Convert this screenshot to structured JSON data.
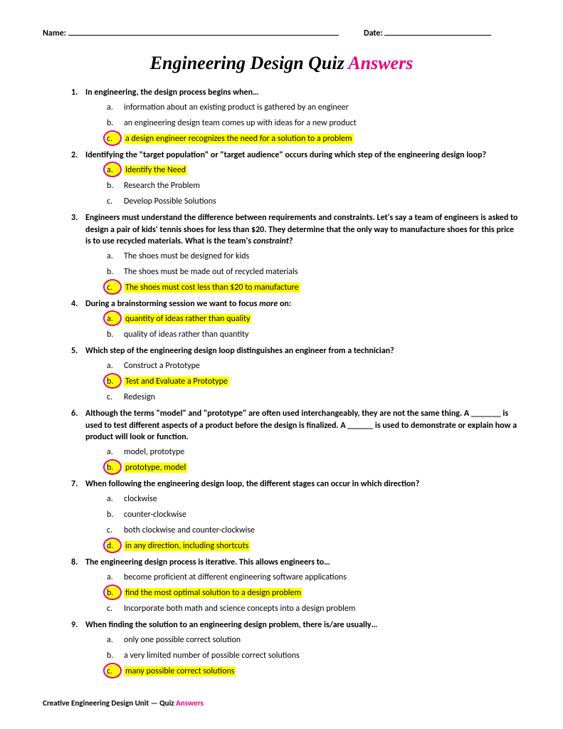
{
  "header": {
    "name_label": "Name:",
    "date_label": "Date:"
  },
  "title": {
    "main": "Engineering Design Quiz ",
    "answers": "Answers"
  },
  "questions": [
    {
      "text": "In engineering, the design process begins when…",
      "choices": [
        {
          "letter": "a.",
          "text": "information about an existing product is gathered by an engineer",
          "correct": false
        },
        {
          "letter": "b.",
          "text": "an engineering design team comes up with ideas for a new product",
          "correct": false
        },
        {
          "letter": "c.",
          "text": "a design engineer recognizes the need for a solution to a problem",
          "correct": true
        }
      ]
    },
    {
      "text": "Identifying the \"target population\" or \"target audience\" occurs during which step of the engineering design loop?",
      "choices": [
        {
          "letter": "a.",
          "text": "Identify the Need",
          "correct": true
        },
        {
          "letter": "b.",
          "text": "Research the Problem",
          "correct": false
        },
        {
          "letter": "c.",
          "text": "Develop Possible Solutions",
          "correct": false
        }
      ]
    },
    {
      "text_html": "Engineers must understand the difference between requirements and constraints. Let's say a team of engineers is asked to design a pair of kids' tennis shoes for less than $20. They determine that the only way to manufacture shoes for this price is to use recycled materials. What is the team's <span class=\"italic\">constraint</span>?",
      "choices": [
        {
          "letter": "a.",
          "text": "The shoes must be designed for kids",
          "correct": false
        },
        {
          "letter": "b.",
          "text": "The shoes must be made out of recycled materials",
          "correct": false
        },
        {
          "letter": "c.",
          "text": "The shoes must cost less than $20 to manufacture",
          "correct": true
        }
      ]
    },
    {
      "text_html": "During a brainstorming session we want to focus <span class=\"italic\">more</span> on:",
      "choices": [
        {
          "letter": "a.",
          "text": "quantity of ideas rather than quality",
          "correct": true
        },
        {
          "letter": "b.",
          "text": "quality of ideas rather than quantity",
          "correct": false
        }
      ]
    },
    {
      "text": "Which step of the engineering design loop distinguishes an engineer from a technician?",
      "choices": [
        {
          "letter": "a.",
          "text": "Construct a Prototype",
          "correct": false
        },
        {
          "letter": "b.",
          "text": "Test and Evaluate a Prototype",
          "correct": true
        },
        {
          "letter": "c.",
          "text": "Redesign",
          "correct": false
        }
      ]
    },
    {
      "text": "Although the terms \"model\" and \"prototype\" are often used interchangeably, they are not the same thing. A _______ is used to test different aspects of a product before the design is finalized. A ______ is used to demonstrate or explain how a product will look or function.",
      "choices": [
        {
          "letter": "a.",
          "text": "model, prototype",
          "correct": false
        },
        {
          "letter": "b.",
          "text": "prototype, model",
          "correct": true
        }
      ]
    },
    {
      "text": "When following the engineering design loop, the different stages can occur in which direction?",
      "choices": [
        {
          "letter": "a.",
          "text": "clockwise",
          "correct": false
        },
        {
          "letter": "b.",
          "text": "counter-clockwise",
          "correct": false
        },
        {
          "letter": "c.",
          "text": "both clockwise and counter-clockwise",
          "correct": false
        },
        {
          "letter": "d.",
          "text": "in any direction, including shortcuts",
          "correct": true
        }
      ]
    },
    {
      "text": "The engineering design process is iterative. This allows engineers to…",
      "choices": [
        {
          "letter": "a.",
          "text": "become proficient at different engineering software applications",
          "correct": false
        },
        {
          "letter": "b.",
          "text": "find the most optimal solution to a design problem",
          "correct": true
        },
        {
          "letter": "c.",
          "text": "Incorporate both math and science concepts into a design problem",
          "correct": false
        }
      ]
    },
    {
      "text": "When finding the solution to an engineering design problem, there is/are usually…",
      "choices": [
        {
          "letter": "a.",
          "text": "only one possible correct solution",
          "correct": false
        },
        {
          "letter": "b.",
          "text": "a very limited number of possible correct solutions",
          "correct": false
        },
        {
          "letter": "c.",
          "text": "many possible correct solutions",
          "correct": true
        }
      ]
    }
  ],
  "footer": {
    "text": "Creative Engineering Design Unit — Quiz ",
    "answers": "Answers"
  }
}
